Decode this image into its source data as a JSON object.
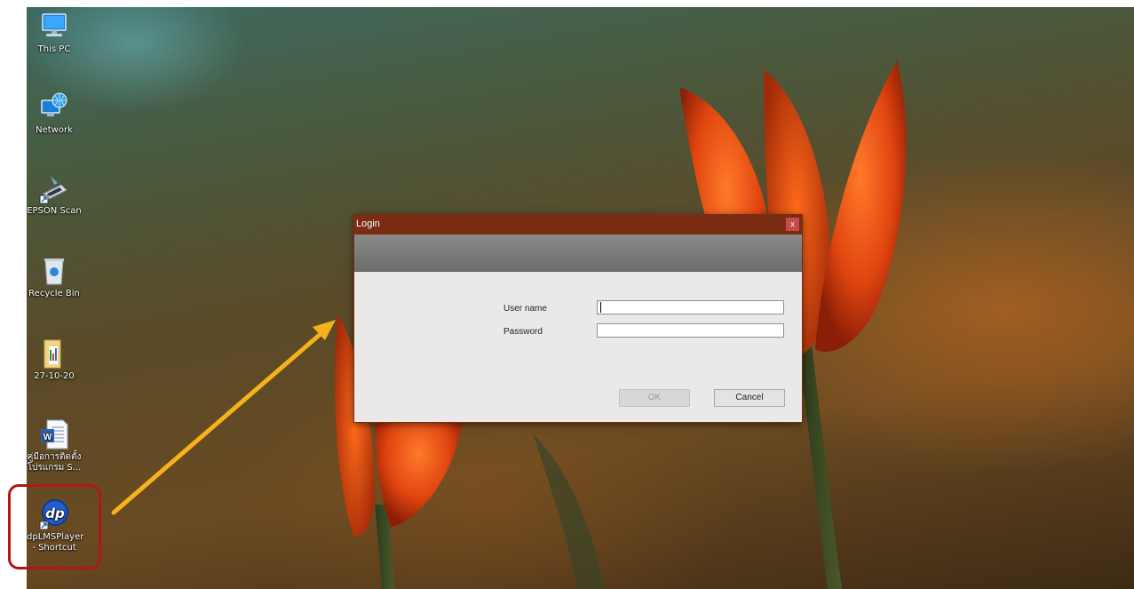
{
  "desktop_icons": [
    {
      "label": "This PC",
      "icon": "this-pc-icon"
    },
    {
      "label": "Network",
      "icon": "network-icon"
    },
    {
      "label": "EPSON Scan",
      "icon": "epson-scan-icon"
    },
    {
      "label": "Recycle Bin",
      "icon": "recycle-bin-icon"
    },
    {
      "label": "27-10-20",
      "icon": "folder-icon"
    },
    {
      "label": "คู่มือการติดตั้ง\nโปรแกรม S...",
      "icon": "word-document-icon"
    },
    {
      "label": "dpLMSPlayer\n- Shortcut",
      "icon": "dp-app-icon",
      "logo_text": "dp"
    }
  ],
  "dialog": {
    "title": "Login",
    "close_label": "x",
    "username_label": "User name",
    "username_value": "",
    "password_label": "Password",
    "password_value": "",
    "ok_label": "OK",
    "ok_enabled": false,
    "cancel_label": "Cancel"
  },
  "annotation": {
    "highlight_color": "#b01818",
    "arrow_color": "#f5b21a"
  },
  "colors": {
    "titlebar": "#7b2d12",
    "close_button": "#c64b4b",
    "dialog_body": "#ebe9e7"
  }
}
